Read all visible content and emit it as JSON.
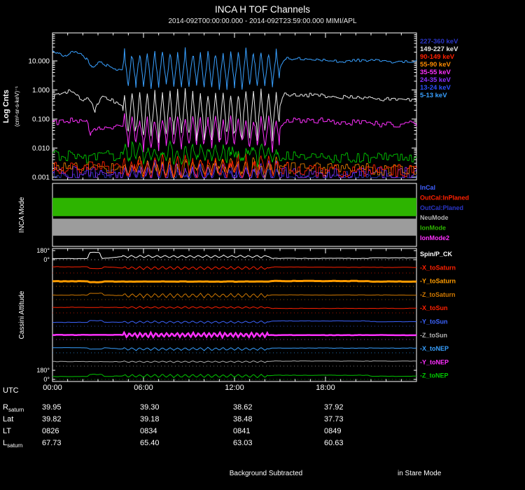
{
  "header": {
    "title": "INCA H TOF Channels",
    "subtitle": "2014-092T00:00:00.000 - 2014-092T23:59:00.000 MIMI/APL"
  },
  "footer": {
    "utc_label": "UTC",
    "time_ticks": [
      "00:00",
      "06:00",
      "12:00",
      "18:00"
    ],
    "rows": [
      {
        "label": "R",
        "sub": "saturn",
        "values": [
          "39.95",
          "39.30",
          "38.62",
          "37.92"
        ]
      },
      {
        "label": "Lat",
        "sub": "",
        "values": [
          "39.82",
          "39.18",
          "38.48",
          "37.73"
        ]
      },
      {
        "label": "LT",
        "sub": "",
        "values": [
          "0826",
          "0834",
          "0841",
          "0849"
        ]
      },
      {
        "label": "L",
        "sub": "saturn",
        "values": [
          "67.73",
          "65.40",
          "63.03",
          "60.63"
        ]
      }
    ],
    "background_note": "Background Subtracted",
    "mode_note": "in Stare Mode"
  },
  "chart_data": [
    {
      "type": "line",
      "ylabel": "Log Cnts",
      "ylabel_units": "(cm²-sr-s-keV)⁻¹",
      "yscale": "log",
      "ylim": [
        0.001,
        90
      ],
      "ytick_labels": [
        "10.000",
        "1.000",
        "0.100",
        "0.010",
        "0.001"
      ],
      "ytick_values": [
        10,
        1,
        0.1,
        0.01,
        0.001
      ],
      "xlim_hours": [
        0,
        24
      ],
      "xtick_hours": [
        0,
        6,
        12,
        18
      ],
      "legend": [
        {
          "label": "227-360 keV",
          "color": "#2a35c8"
        },
        {
          "label": "149-227 keV",
          "color": "#e8e8e8"
        },
        {
          "label": "90-149 keV",
          "color": "#ff2000"
        },
        {
          "label": "55-90 keV",
          "color": "#ff8c00"
        },
        {
          "label": "35-55 keV",
          "color": "#ff30ff"
        },
        {
          "label": "24-35 keV",
          "color": "#8c30ff"
        },
        {
          "label": "13-24 keV",
          "color": "#2a50ff"
        },
        {
          "label": "5-13 keV",
          "color": "#38a0ff"
        }
      ],
      "series": [
        {
          "name": "227-360 keV",
          "color": "#2a35c8",
          "width": 0.8,
          "noise": 0.2,
          "base": [
            [
              0,
              0.0012
            ],
            [
              24,
              0.0011
            ]
          ],
          "osc": {
            "start": 4.6,
            "end": 15,
            "amp": 0.25,
            "period": 0.5,
            "bias": 0
          }
        },
        {
          "name": "24-35 keV",
          "color": "#8c30ff",
          "width": 0.8,
          "noise": 0.22,
          "base": [
            [
              0,
              0.0014
            ],
            [
              24,
              0.0013
            ]
          ],
          "osc": {
            "start": 4.6,
            "end": 15,
            "amp": 0.3,
            "period": 0.5,
            "bias": -0.1
          }
        },
        {
          "name": "55-90 keV",
          "color": "#ff8c00",
          "width": 0.8,
          "noise": 0.2,
          "base": [
            [
              0,
              0.0025
            ],
            [
              4.6,
              0.002
            ],
            [
              15,
              0.002
            ],
            [
              24,
              0.0018
            ]
          ],
          "osc": {
            "start": 4.6,
            "end": 15,
            "amp": 0.3,
            "period": 0.5,
            "bias": -0.1
          }
        },
        {
          "name": "90-149 keV",
          "color": "#ff2000",
          "width": 0.9,
          "noise": 0.22,
          "base": [
            [
              0,
              0.002
            ],
            [
              3,
              0.0022
            ],
            [
              4.6,
              0.0018
            ],
            [
              15,
              0.002
            ],
            [
              20,
              0.0016
            ],
            [
              24,
              0.0017
            ]
          ],
          "osc": {
            "start": 4.6,
            "end": 15,
            "amp": 0.35,
            "period": 0.5,
            "bias": -0.15
          }
        },
        {
          "name": "bkg",
          "color": "#00c800",
          "width": 0.9,
          "noise": 0.2,
          "base": [
            [
              0,
              0.006
            ],
            [
              2.5,
              0.0045
            ],
            [
              4.6,
              0.006
            ],
            [
              15,
              0.0058
            ],
            [
              17,
              0.005
            ],
            [
              21,
              0.0045
            ],
            [
              24,
              0.005
            ]
          ],
          "osc": {
            "start": 4.6,
            "end": 15,
            "amp": 0.3,
            "period": 0.5,
            "bias": -0.2
          }
        },
        {
          "name": "35-55 keV",
          "color": "#ff30ff",
          "width": 1,
          "noise": 0.1,
          "base": [
            [
              0,
              0.075
            ],
            [
              1.5,
              0.09
            ],
            [
              2.2,
              0.085
            ],
            [
              2.5,
              0.032
            ],
            [
              3.4,
              0.05
            ],
            [
              4.6,
              0.05
            ],
            [
              15,
              0.05
            ],
            [
              15.3,
              0.095
            ],
            [
              17.5,
              0.09
            ],
            [
              20,
              0.075
            ],
            [
              22,
              0.065
            ],
            [
              24,
              0.068
            ]
          ],
          "osc": {
            "start": 4.6,
            "end": 15,
            "amp": 0.62,
            "period": 0.5,
            "bias": 0.28
          }
        },
        {
          "name": "149-227 keV",
          "color": "#e8e8e8",
          "width": 1,
          "noise": 0.07,
          "base": [
            [
              0,
              0.55
            ],
            [
              1.1,
              0.95
            ],
            [
              1.8,
              0.5
            ],
            [
              2.4,
              0.45
            ],
            [
              2.8,
              0.18
            ],
            [
              3.3,
              0.55
            ],
            [
              4.6,
              0.32
            ],
            [
              15,
              0.32
            ],
            [
              15.3,
              0.7
            ],
            [
              17,
              0.66
            ],
            [
              20,
              0.55
            ],
            [
              24,
              0.42
            ]
          ],
          "osc": {
            "start": 4.6,
            "end": 15,
            "amp": 0.95,
            "period": 0.5,
            "bias": 0.42
          }
        },
        {
          "name": "5-13 keV",
          "color": "#38a0ff",
          "width": 1,
          "noise": 0.05,
          "base": [
            [
              0,
              24
            ],
            [
              0.7,
              14
            ],
            [
              1.3,
              20
            ],
            [
              2.0,
              16
            ],
            [
              2.6,
              6
            ],
            [
              3.2,
              9
            ],
            [
              4.0,
              5
            ],
            [
              4.6,
              5
            ],
            [
              15,
              5
            ],
            [
              15.35,
              12
            ],
            [
              17,
              11.5
            ],
            [
              19,
              9.5
            ],
            [
              21,
              11
            ],
            [
              22.5,
              9
            ],
            [
              24,
              10
            ]
          ],
          "osc": {
            "start": 4.6,
            "end": 15,
            "amp": 0.72,
            "period": 0.5,
            "bias": -0.05
          }
        }
      ]
    },
    {
      "type": "mode-bars",
      "ylabel": "INCA Mode",
      "legend": [
        {
          "label": "InCal",
          "color": "#4060ff"
        },
        {
          "label": "OutCal:InPlaned",
          "color": "#ff2000"
        },
        {
          "label": "OutCal:Planed",
          "color": "#2a35c8"
        },
        {
          "label": "NeuMode",
          "color": "#b0b0b0"
        },
        {
          "label": "IonMode",
          "color": "#2db400"
        },
        {
          "label": "IonMode2",
          "color": "#ff30ff"
        }
      ],
      "bars": [
        {
          "mode": "IonMode",
          "color": "#2db400",
          "start_h": 0,
          "end_h": 24,
          "y_frac": 0.23,
          "h_frac": 0.29
        },
        {
          "mode": "NeuMode",
          "color": "#9c9c9c",
          "start_h": 0,
          "end_h": 24,
          "y_frac": 0.56,
          "h_frac": 0.27
        }
      ]
    },
    {
      "type": "line",
      "ylabel": "Cassini Attitude",
      "yunits": "deg",
      "ytick_labels": [
        "180°",
        "0°",
        "180°",
        "0°"
      ],
      "legend": [
        {
          "label": "Spin/P_CK",
          "color": "#ffffff"
        },
        {
          "label": "-X_toSaturn",
          "color": "#ff2000"
        },
        {
          "label": "-Y_toSaturn",
          "color": "#ff9c00"
        },
        {
          "label": "-Z_toSaturn",
          "color": "#d07800"
        },
        {
          "label": "-X_toSun",
          "color": "#ff2000"
        },
        {
          "label": "-Y_toSun",
          "color": "#3c64ff"
        },
        {
          "label": "-Z_toSun",
          "color": "#b0b0b0"
        },
        {
          "label": "-X_toNEP",
          "color": "#38a0ff"
        },
        {
          "label": "-Y_toNEP",
          "color": "#ff30ff"
        },
        {
          "label": "-Z_toNEP",
          "color": "#00c800"
        }
      ],
      "series": [
        {
          "name": "Spin/P_CK",
          "color": "#ffffff",
          "width": 1,
          "band": 0,
          "base": [
            [
              0,
              0.12
            ],
            [
              2.3,
              0.12
            ],
            [
              2.45,
              0.8
            ],
            [
              3.1,
              0.8
            ],
            [
              3.25,
              0.12
            ],
            [
              4.6,
              0.35
            ],
            [
              14.2,
              0.35
            ],
            [
              14.5,
              0.15
            ],
            [
              20.8,
              0.15
            ],
            [
              21,
              0.2
            ],
            [
              24,
              0.2
            ]
          ],
          "osc": {
            "start": 4.6,
            "end": 14.2,
            "amp": 0.17,
            "period": 0.55
          }
        },
        {
          "name": "-X_toSaturn",
          "color": "#ff2000",
          "width": 1,
          "band": 1,
          "base": [
            [
              0,
              0.68
            ],
            [
              2.3,
              0.68
            ],
            [
              2.45,
              0.5
            ],
            [
              3.25,
              0.5
            ],
            [
              3.4,
              0.68
            ],
            [
              4.6,
              0.55
            ],
            [
              14.2,
              0.55
            ],
            [
              14.5,
              0.65
            ],
            [
              24,
              0.62
            ]
          ],
          "osc": {
            "start": 4.6,
            "end": 14.2,
            "amp": 0.2,
            "period": 0.5
          }
        },
        {
          "name": "-Y_toSaturn",
          "color": "#ff9c00",
          "width": 3,
          "band": 2,
          "base": [
            [
              0,
              0.55
            ],
            [
              2.3,
              0.55
            ],
            [
              2.45,
              0.45
            ],
            [
              3.25,
              0.45
            ],
            [
              3.4,
              0.52
            ],
            [
              14.2,
              0.52
            ],
            [
              14.5,
              0.58
            ],
            [
              20.8,
              0.58
            ],
            [
              21,
              0.52
            ],
            [
              24,
              0.52
            ]
          ]
        },
        {
          "name": "-Z_toSaturn",
          "color": "#d07800",
          "width": 1,
          "band": 3,
          "base": [
            [
              0,
              0.5
            ],
            [
              2.3,
              0.5
            ],
            [
              2.45,
              0.7
            ],
            [
              3.25,
              0.7
            ],
            [
              3.4,
              0.5
            ],
            [
              4.6,
              0.45
            ],
            [
              14.2,
              0.45
            ],
            [
              14.5,
              0.52
            ],
            [
              24,
              0.5
            ]
          ],
          "osc": {
            "start": 4.6,
            "end": 14.2,
            "amp": 0.28,
            "period": 0.5
          }
        },
        {
          "name": "-X_toSun",
          "color": "#ff2000",
          "width": 1,
          "band": 4,
          "base": [
            [
              0,
              0.62
            ],
            [
              4.6,
              0.6
            ],
            [
              14.2,
              0.6
            ],
            [
              14.5,
              0.5
            ],
            [
              24,
              0.5
            ]
          ],
          "osc": {
            "start": 4.6,
            "end": 14.2,
            "amp": 0.12,
            "period": 0.5
          }
        },
        {
          "name": "-Y_toSun",
          "color": "#3c64ff",
          "width": 1,
          "band": 5,
          "base": [
            [
              0,
              0.42
            ],
            [
              2.3,
              0.42
            ],
            [
              2.45,
              0.62
            ],
            [
              3.25,
              0.62
            ],
            [
              3.4,
              0.42
            ],
            [
              4.6,
              0.45
            ],
            [
              14.2,
              0.45
            ],
            [
              14.5,
              0.58
            ],
            [
              20.8,
              0.58
            ],
            [
              21,
              0.5
            ],
            [
              24,
              0.5
            ]
          ],
          "osc": {
            "start": 4.6,
            "end": 14.2,
            "amp": 0.15,
            "period": 0.5
          }
        },
        {
          "name": "-Z_toSun",
          "color": "#b0b0b0",
          "width": 1,
          "band": 8,
          "base": [
            [
              0,
              0.5
            ],
            [
              4.6,
              0.48
            ],
            [
              14.2,
              0.48
            ],
            [
              14.5,
              0.55
            ],
            [
              24,
              0.55
            ]
          ],
          "osc": {
            "start": 4.6,
            "end": 14.2,
            "amp": 0.1,
            "period": 0.5
          }
        },
        {
          "name": "-X_toNEP",
          "color": "#38a0ff",
          "width": 1,
          "band": 7,
          "base": [
            [
              0,
              0.55
            ],
            [
              2.3,
              0.55
            ],
            [
              2.45,
              0.4
            ],
            [
              3.25,
              0.4
            ],
            [
              3.4,
              0.55
            ],
            [
              4.6,
              0.42
            ],
            [
              14.2,
              0.42
            ],
            [
              14.5,
              0.52
            ],
            [
              24,
              0.52
            ]
          ],
          "osc": {
            "start": 4.6,
            "end": 14.2,
            "amp": 0.2,
            "period": 0.5
          }
        },
        {
          "name": "-Y_toNEP",
          "color": "#ff30ff",
          "width": 2.5,
          "band": 6,
          "base": [
            [
              0,
              0.5
            ],
            [
              4.6,
              0.5
            ],
            [
              14.2,
              0.5
            ],
            [
              14.5,
              0.48
            ],
            [
              24,
              0.48
            ]
          ],
          "osc": {
            "start": 4.6,
            "end": 14.2,
            "amp": 0.3,
            "period": 0.35
          }
        },
        {
          "name": "-Z_toNEP",
          "color": "#00c800",
          "width": 1,
          "band": 9,
          "base": [
            [
              0,
              0.32
            ],
            [
              2.3,
              0.32
            ],
            [
              2.45,
              0.55
            ],
            [
              3.25,
              0.55
            ],
            [
              3.4,
              0.32
            ],
            [
              4.6,
              0.38
            ],
            [
              14.2,
              0.38
            ],
            [
              14.5,
              0.45
            ],
            [
              20.8,
              0.45
            ],
            [
              21,
              0.35
            ],
            [
              24,
              0.35
            ]
          ],
          "osc": {
            "start": 4.6,
            "end": 14.2,
            "amp": 0.22,
            "period": 0.5
          }
        }
      ]
    }
  ]
}
